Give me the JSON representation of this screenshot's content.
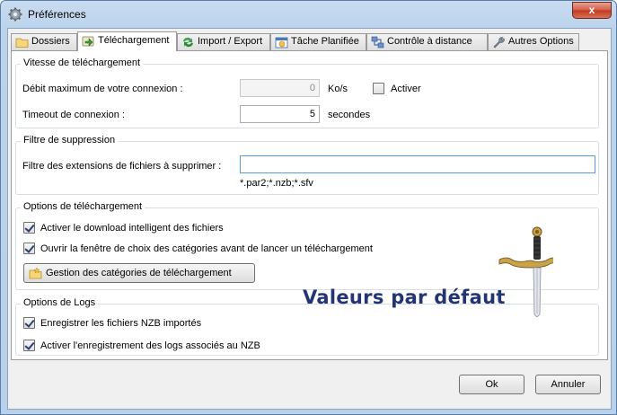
{
  "window": {
    "title": "Préférences",
    "close_label": "x"
  },
  "tabs": [
    {
      "label": "Dossiers",
      "icon": "folder-icon"
    },
    {
      "label": "Téléchargement",
      "icon": "download-icon",
      "active": true
    },
    {
      "label": "Import / Export",
      "icon": "import-export-icon"
    },
    {
      "label": "Tâche Planifiée",
      "icon": "calendar-icon"
    },
    {
      "label": "Contrôle à distance",
      "icon": "network-icon"
    },
    {
      "label": "Autres Options",
      "icon": "wrench-icon"
    }
  ],
  "speed": {
    "title": "Vitesse de téléchargement",
    "max_label": "Débit maximum de votre connexion :",
    "max_value": "0",
    "max_unit": "Ko/s",
    "activate_label": "Activer",
    "activate_checked": false,
    "timeout_label": "Timeout de connexion :",
    "timeout_value": "5",
    "timeout_unit": "secondes"
  },
  "filter": {
    "title": "Filtre de suppression",
    "label": "Filtre des extensions de fichiers à supprimer :",
    "value": "",
    "hint": "*.par2;*.nzb;*.sfv"
  },
  "download_options": {
    "title": "Options de téléchargement",
    "smart_label": "Activer le download intelligent des fichiers",
    "smart_checked": true,
    "categories_label": "Ouvrir la fenêtre de choix des catégories avant de lancer un téléchargement",
    "categories_checked": true,
    "manage_button": "Gestion des catégories de téléchargement"
  },
  "logs": {
    "title": "Options de Logs",
    "nzb_label": "Enregistrer les fichiers NZB importés",
    "nzb_checked": true,
    "logs_label": "Activer l'enregistrement des logs associés au NZB",
    "logs_checked": true
  },
  "defaults_label": "Valeurs par défaut",
  "footer": {
    "ok": "Ok",
    "cancel": "Annuler"
  },
  "colors": {
    "accent": "#233475",
    "title_bar": "#bcd3ec",
    "close": "#c0391f"
  }
}
